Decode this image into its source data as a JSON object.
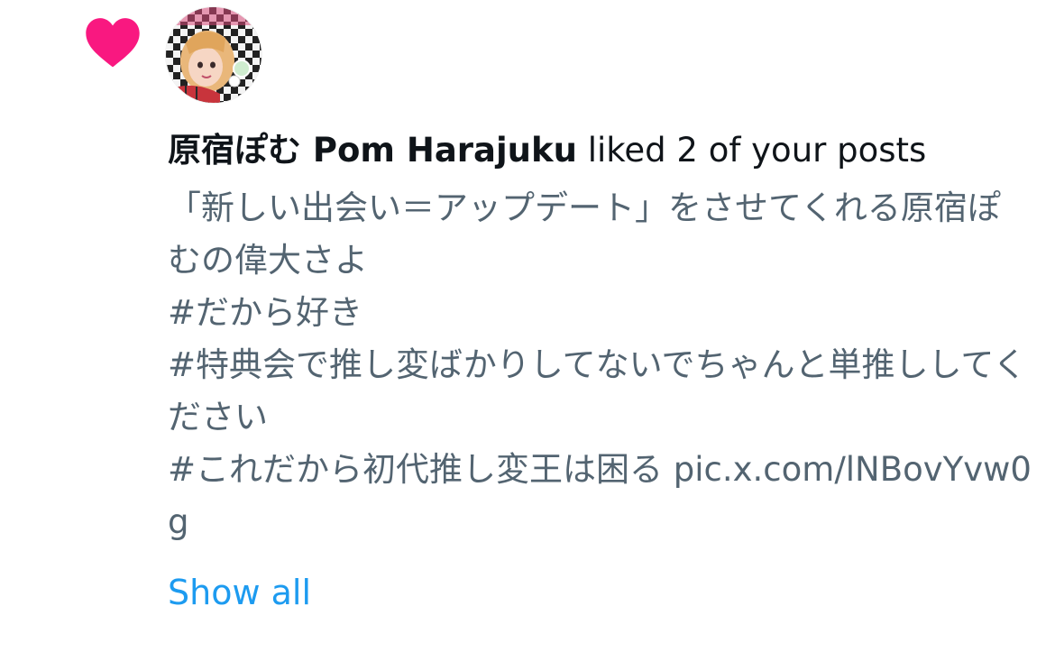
{
  "notification": {
    "icon": "heart-icon",
    "icon_color": "#f91880",
    "user_name": "原宿ぽむ Pom Harajuku",
    "action_text": "liked 2 of your posts",
    "post_text": "「新しい出会い＝アップデート」をさせてくれる原宿ぽむの偉大さよ\n#だから好き\n#特典会で推し変ばかりしてないでちゃんと単推ししてください\n#これだから初代推し変王は困る pic.x.com/lNBovYvw0g",
    "show_all_label": "Show all",
    "link_color": "#1d9bf0"
  }
}
